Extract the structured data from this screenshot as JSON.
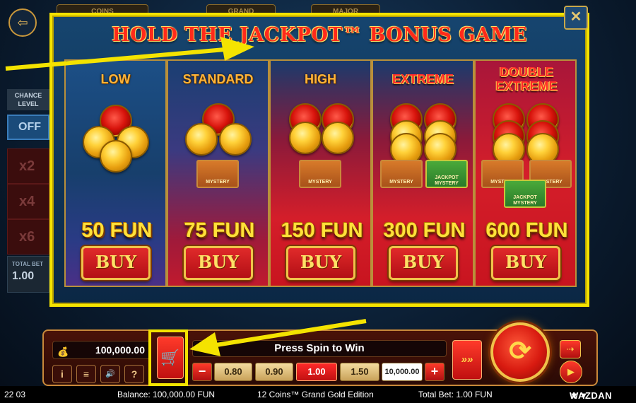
{
  "background": {
    "tabs": [
      "COINS",
      "GRAND",
      "MAJOR"
    ],
    "chance_level": {
      "label": "CHANCE LEVEL",
      "off_label": "OFF",
      "multipliers": [
        "x2",
        "x4",
        "x6"
      ]
    },
    "total_bet_box": {
      "label": "TOTAL BET",
      "value": "1.00"
    }
  },
  "popup": {
    "title": "HOLD THE JACKPOT™ BONUS GAME",
    "tiers": [
      {
        "label": "LOW",
        "price": "50 FUN",
        "buy_label": "BUY"
      },
      {
        "label": "STANDARD",
        "price": "75 FUN",
        "buy_label": "BUY",
        "chests": [
          "MYSTERY"
        ]
      },
      {
        "label": "HIGH",
        "price": "150 FUN",
        "buy_label": "BUY",
        "chests": [
          "MYSTERY"
        ]
      },
      {
        "label": "EXTREME",
        "price": "300 FUN",
        "buy_label": "BUY",
        "chests": [
          "MYSTERY",
          "JACKPOT MYSTERY"
        ]
      },
      {
        "label": "DOUBLE EXTREME",
        "price": "600 FUN",
        "buy_label": "BUY",
        "chests": [
          "MYSTERY",
          "MYSTERY",
          "JACKPOT MYSTERY"
        ]
      }
    ]
  },
  "bottom_bar": {
    "balance": "100,000.00",
    "message": "Press Spin to Win",
    "bet_levels": [
      "0.80",
      "0.90",
      "1.00",
      "1.50",
      "10,000.00"
    ],
    "selected_bet": "1.00",
    "minus": "−",
    "plus": "+",
    "info": "i",
    "menu": "≡",
    "sound": "🔊",
    "help": "?"
  },
  "status": {
    "time": "22 03",
    "balance_text": "Balance: 100,000.00 FUN",
    "game_name": "12 Coins™ Grand Gold Edition",
    "total_bet_text": "Total Bet: 1.00 FUN",
    "brand": "WAZDAN"
  },
  "colors": {
    "highlight": "#f4e300",
    "gold": "#ffe13a",
    "red": "#d41e2a"
  }
}
